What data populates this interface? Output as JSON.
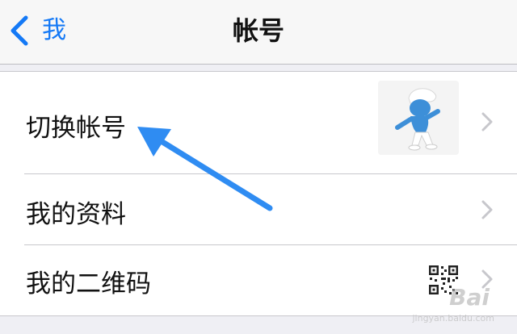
{
  "navbar": {
    "back_label": "我",
    "title": "帐号"
  },
  "rows": [
    {
      "label": "切换帐号",
      "accessory": "avatar-image"
    },
    {
      "label": "我的资料"
    },
    {
      "label": "我的二维码",
      "accessory": "qr-code-icon"
    }
  ],
  "colors": {
    "accent": "#1479f6",
    "background": "#efeff4",
    "annotation_arrow": "#2f8cf2"
  },
  "watermark": {
    "text": "Bai",
    "sub": "jingyan.baidu.com"
  }
}
